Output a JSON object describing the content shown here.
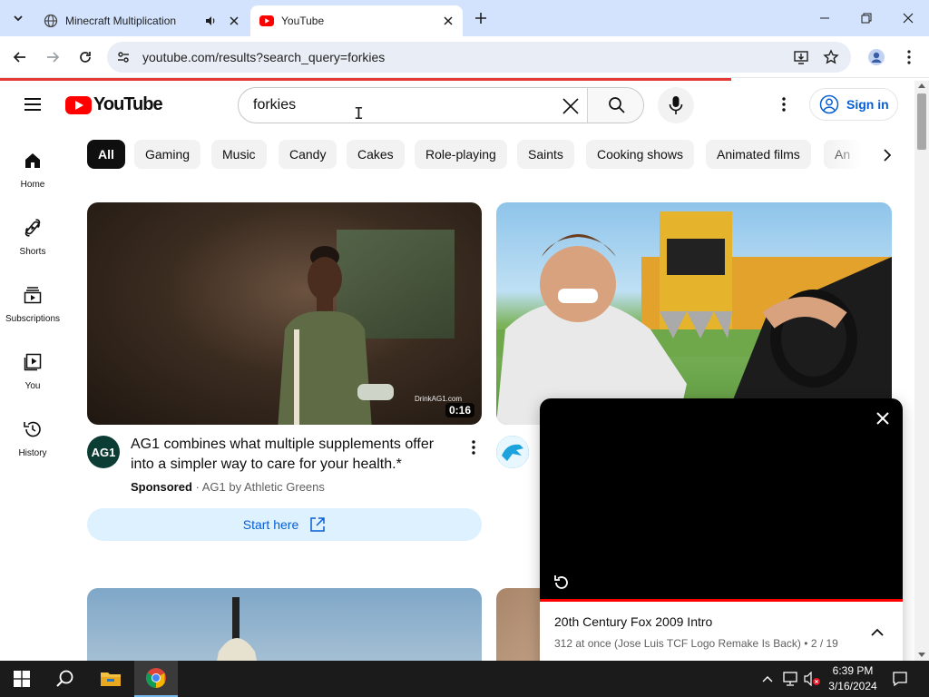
{
  "browser": {
    "tabs": [
      {
        "title": "Minecraft Multiplication",
        "active": false
      },
      {
        "title": "YouTube",
        "active": true
      }
    ],
    "url": "youtube.com/results?search_query=forkies"
  },
  "youtube": {
    "logo_text": "YouTube",
    "search_query": "forkies",
    "signin_label": "Sign in",
    "chips": [
      "All",
      "Gaming",
      "Music",
      "Candy",
      "Cakes",
      "Role-playing",
      "Saints",
      "Cooking shows",
      "Animated films",
      "An"
    ],
    "guide": [
      {
        "label": "Home",
        "icon": "home-icon"
      },
      {
        "label": "Shorts",
        "icon": "shorts-icon"
      },
      {
        "label": "Subscriptions",
        "icon": "subscriptions-icon"
      },
      {
        "label": "You",
        "icon": "you-icon"
      },
      {
        "label": "History",
        "icon": "history-icon"
      }
    ],
    "ad": {
      "avatar_text": "AG1",
      "title": "AG1 combines what multiple supplements offer into a simpler way to care for your health.*",
      "sponsored": "Sponsored",
      "advertiser": "AG1 by Athletic Greens",
      "duration": "0:16",
      "watermark": "DrinkAG1.com",
      "cta": "Start here"
    },
    "miniplayer": {
      "title": "20th Century Fox 2009 Intro",
      "subtitle": "312 at once (Jose Luis TCF Logo Remake Is Back)",
      "position": "2 / 19"
    }
  },
  "taskbar": {
    "time": "6:39 PM",
    "date": "3/16/2024"
  },
  "colors": {
    "youtube_red": "#ff0000",
    "link_blue": "#065fd4",
    "tabstrip": "#d3e3fd"
  }
}
